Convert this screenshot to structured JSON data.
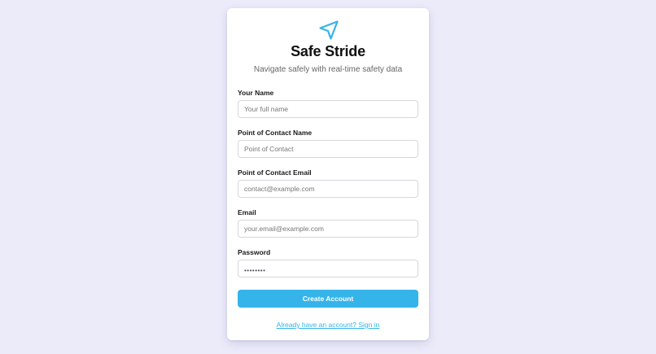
{
  "brand": {
    "title": "Safe Stride",
    "subtitle": "Navigate safely with real-time safety data",
    "logo_icon": "navigation-arrow-icon",
    "accent_color": "#35b4ea"
  },
  "form": {
    "fields": [
      {
        "label": "Your Name",
        "placeholder": "Your full name",
        "type": "text"
      },
      {
        "label": "Point of Contact Name",
        "placeholder": "Point of Contact",
        "type": "text"
      },
      {
        "label": "Point of Contact Email",
        "placeholder": "contact@example.com",
        "type": "email"
      },
      {
        "label": "Email",
        "placeholder": "your.email@example.com",
        "type": "email"
      },
      {
        "label": "Password",
        "placeholder": "",
        "value_masked": "••••••••",
        "type": "password"
      }
    ],
    "submit_label": "Create Account",
    "signin_link": "Already have an account? Sign in"
  }
}
